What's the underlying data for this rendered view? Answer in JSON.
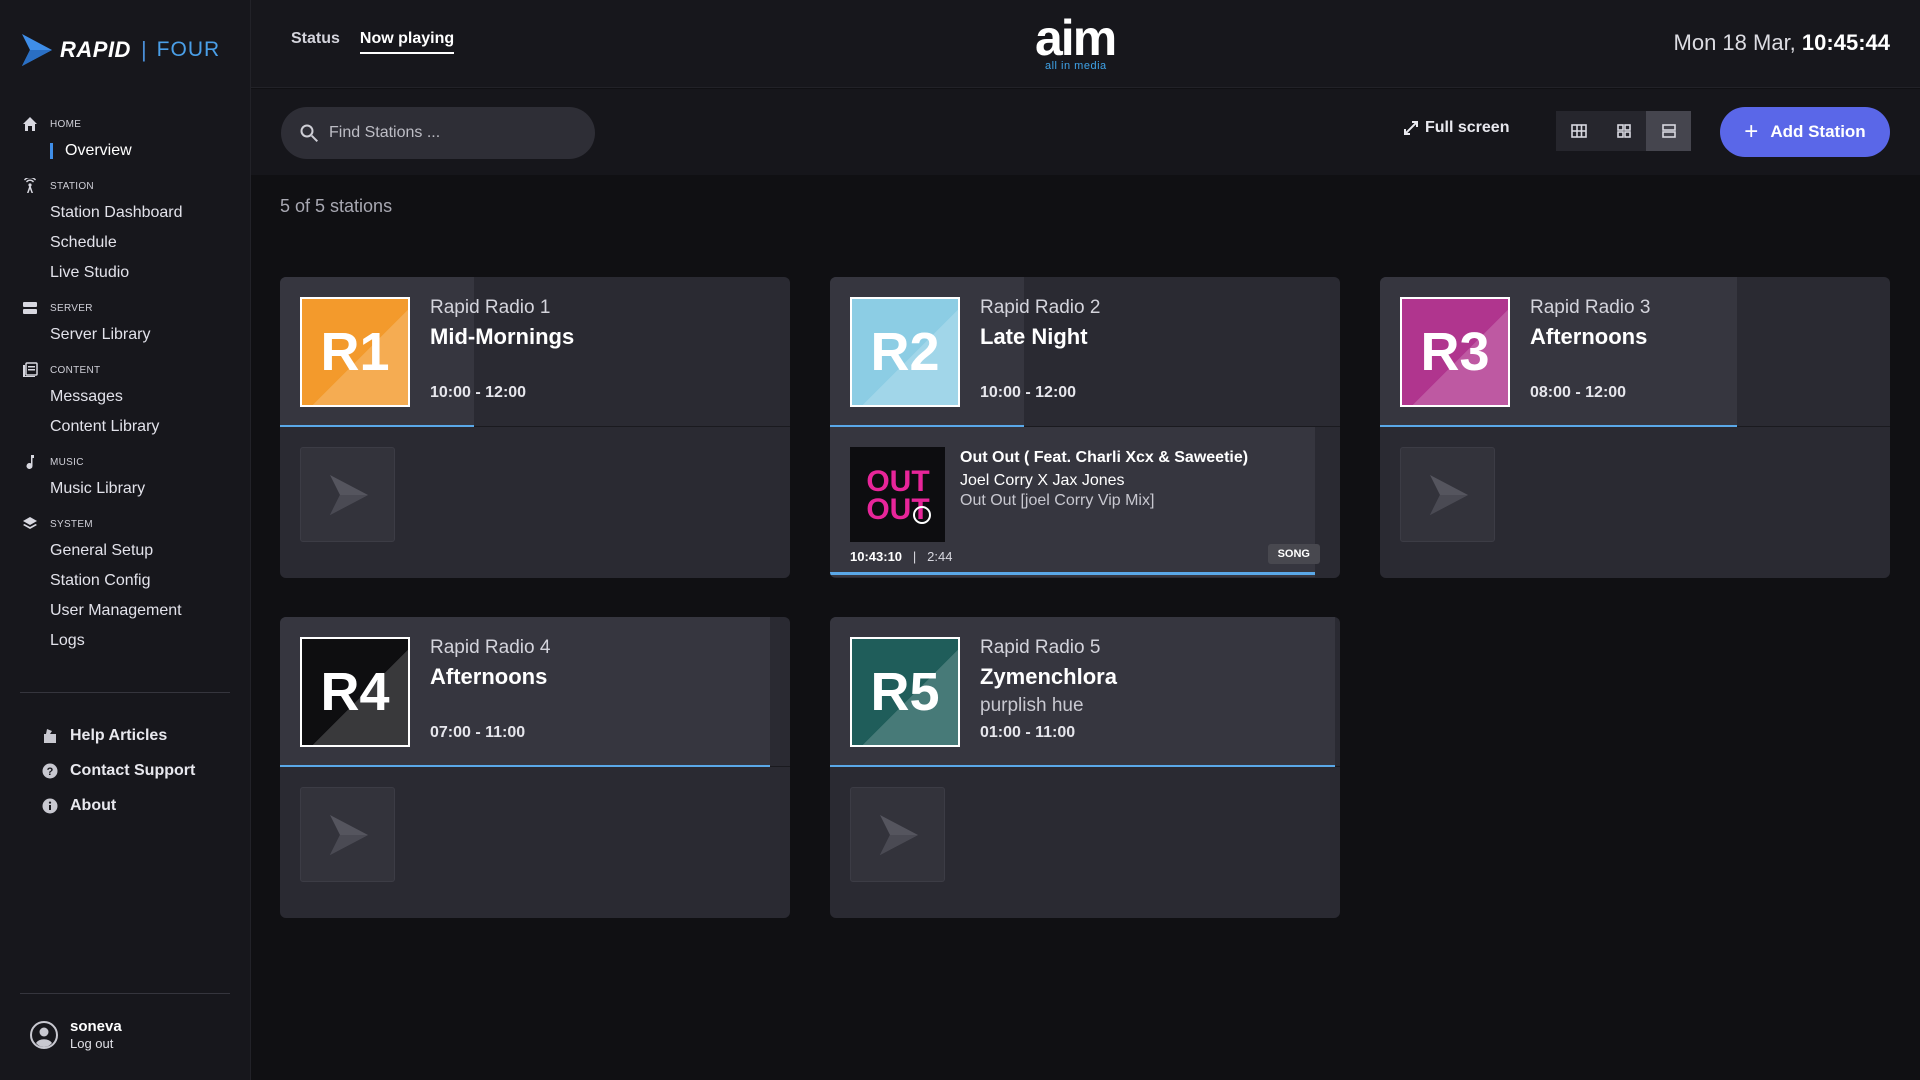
{
  "brand": {
    "name": "RAPID",
    "separator": "|",
    "product": "FOUR"
  },
  "nav": {
    "home": {
      "label": "HOME",
      "items": [
        "Overview"
      ]
    },
    "station": {
      "label": "STATION",
      "items": [
        "Station Dashboard",
        "Schedule",
        "Live Studio"
      ]
    },
    "server": {
      "label": "SERVER",
      "items": [
        "Server Library"
      ]
    },
    "content": {
      "label": "CONTENT",
      "items": [
        "Messages",
        "Content Library"
      ]
    },
    "music": {
      "label": "MUSIC",
      "items": [
        "Music Library"
      ]
    },
    "system": {
      "label": "SYSTEM",
      "items": [
        "General Setup",
        "Station Config",
        "User Management",
        "Logs"
      ]
    }
  },
  "help": {
    "items": [
      "Help Articles",
      "Contact Support",
      "About"
    ]
  },
  "user": {
    "name": "soneva",
    "logout": "Log out"
  },
  "header": {
    "tabs": [
      "Status",
      "Now playing"
    ],
    "logo_word": "aim",
    "logo_tagline": "all in media",
    "date": "Mon 18 Mar,",
    "time": "10:45:44"
  },
  "toolbar": {
    "search_placeholder": "Find Stations ...",
    "fullscreen_label": "Full screen",
    "add_station_label": "Add Station"
  },
  "station_count": "5 of 5 stations",
  "colors": {
    "accent": "#5a67e8",
    "progress": "#5aa8e8"
  },
  "stations": [
    {
      "code": "R1",
      "name": "Rapid Radio 1",
      "show": "Mid-Mornings",
      "subtitle": "",
      "time": "10:00 - 12:00",
      "progress": 0.38,
      "logo_color": "#f39a2c"
    },
    {
      "code": "R2",
      "name": "Rapid Radio 2",
      "show": "Late Night",
      "subtitle": "",
      "time": "10:00 - 12:00",
      "progress": 0.38,
      "logo_color": "#8ccde4",
      "now_playing": {
        "title": "Out Out ( Feat. Charli Xcx & Saweetie)",
        "artist": "Joel Corry X Jax Jones",
        "album": "Out Out [joel Corry Vip Mix]",
        "start": "10:43:10",
        "duration": "2:44",
        "type": "SONG",
        "art_text": "OUT OUT",
        "progress": 0.95
      }
    },
    {
      "code": "R3",
      "name": "Rapid Radio 3",
      "show": "Afternoons",
      "subtitle": "",
      "time": "08:00 - 12:00",
      "progress": 0.7,
      "logo_color": "#b0358e"
    },
    {
      "code": "R4",
      "name": "Rapid Radio 4",
      "show": "Afternoons",
      "subtitle": "",
      "time": "07:00 - 11:00",
      "progress": 0.96,
      "logo_color": "#0e0e10"
    },
    {
      "code": "R5",
      "name": "Rapid Radio 5",
      "show": "Zymenchlora",
      "subtitle": "purplish hue",
      "time": "01:00 - 11:00",
      "progress": 0.99,
      "logo_color": "#1f5d5a"
    }
  ]
}
